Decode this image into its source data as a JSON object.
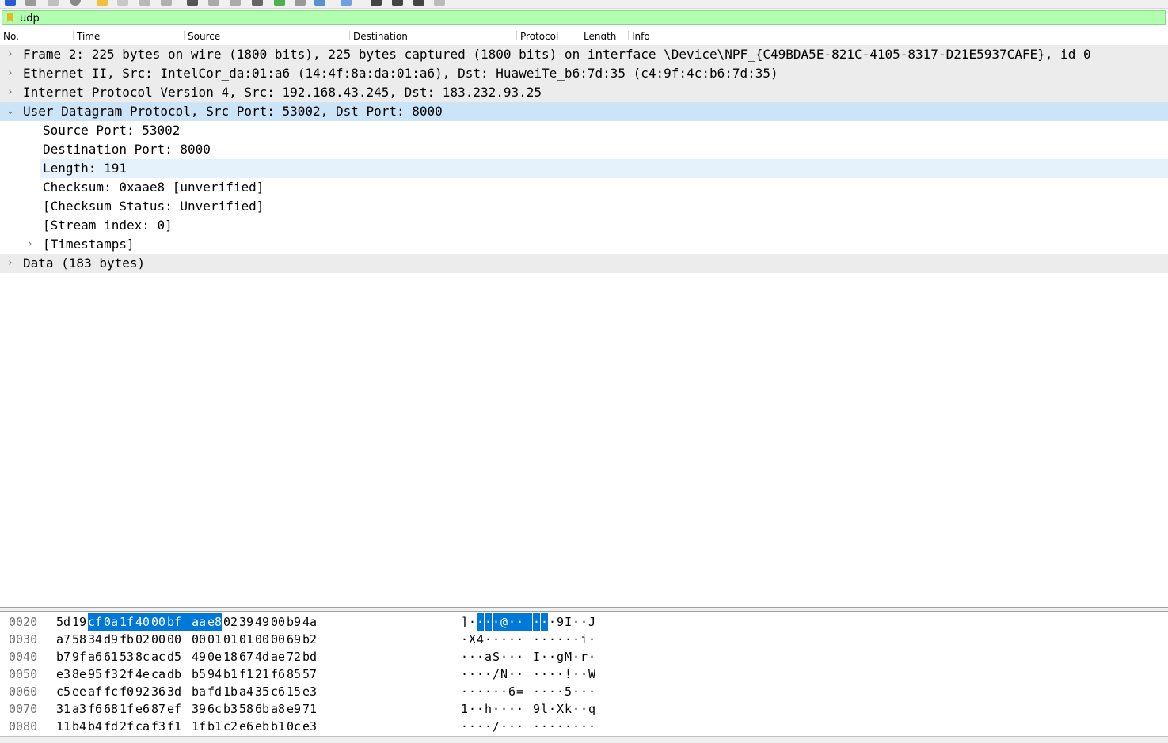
{
  "filter": {
    "value": "udp"
  },
  "packet_list": {
    "columns": [
      "No.",
      "Time",
      "Source",
      "Destination",
      "Protocol",
      "Length",
      "Info"
    ]
  },
  "detail": {
    "rows": [
      {
        "text": "Frame 2: 225 bytes on wire (1800 bits), 225 bytes captured (1800 bits) on interface \\Device\\NPF_{C49BDA5E-821C-4105-8317-D21E5937CAFE}, id 0",
        "expanded": false
      },
      {
        "text": "Ethernet II, Src: IntelCor_da:01:a6 (14:4f:8a:da:01:a6), Dst: HuaweiTe_b6:7d:35 (c4:9f:4c:b6:7d:35)",
        "expanded": false
      },
      {
        "text": "Internet Protocol Version 4, Src: 192.168.43.245, Dst: 183.232.93.25",
        "expanded": false
      },
      {
        "text": "User Datagram Protocol, Src Port: 53002, Dst Port: 8000",
        "expanded": true,
        "selected": true
      },
      {
        "text": "Source Port: 53002"
      },
      {
        "text": "Destination Port: 8000"
      },
      {
        "text": "Length: 191",
        "hovered": true
      },
      {
        "text": "Checksum: 0xaae8 [unverified]"
      },
      {
        "text": "[Checksum Status: Unverified]"
      },
      {
        "text": "[Stream index: 0]"
      },
      {
        "text": "[Timestamps]",
        "expanded": false
      },
      {
        "text": "Data (183 bytes)",
        "expanded": false
      }
    ]
  },
  "bytes": {
    "rows": [
      {
        "offset": "0020",
        "hex": [
          "5d",
          "19",
          "cf",
          "0a",
          "1f",
          "40",
          "00",
          "bf",
          "aa",
          "e8",
          "02",
          "39",
          "49",
          "00",
          "b9",
          "4a"
        ],
        "ascii": [
          "]",
          "·",
          "·",
          "·",
          "·",
          "@",
          "·",
          "·",
          "·",
          "·",
          "·",
          "9",
          "I",
          "·",
          "·",
          "J"
        ]
      },
      {
        "offset": "0030",
        "hex": [
          "a7",
          "58",
          "34",
          "d9",
          "fb",
          "02",
          "00",
          "00",
          "00",
          "01",
          "01",
          "01",
          "00",
          "00",
          "69",
          "b2"
        ],
        "ascii": [
          "·",
          "X",
          "4",
          "·",
          "·",
          "·",
          "·",
          "·",
          "·",
          "·",
          "·",
          "·",
          "·",
          "·",
          "i",
          "·"
        ]
      },
      {
        "offset": "0040",
        "hex": [
          "b7",
          "9f",
          "a6",
          "61",
          "53",
          "8c",
          "ac",
          "d5",
          "49",
          "0e",
          "18",
          "67",
          "4d",
          "ae",
          "72",
          "bd"
        ],
        "ascii": [
          "·",
          "·",
          "·",
          "a",
          "S",
          "·",
          "·",
          "·",
          "I",
          "·",
          "·",
          "g",
          "M",
          "·",
          "r",
          "·"
        ]
      },
      {
        "offset": "0050",
        "hex": [
          "e3",
          "8e",
          "95",
          "f3",
          "2f",
          "4e",
          "ca",
          "db",
          "b5",
          "94",
          "b1",
          "f1",
          "21",
          "f6",
          "85",
          "57"
        ],
        "ascii": [
          "·",
          "·",
          "·",
          "·",
          "/",
          "N",
          "·",
          "·",
          "·",
          "·",
          "·",
          "·",
          "!",
          "·",
          "·",
          "W"
        ]
      },
      {
        "offset": "0060",
        "hex": [
          "c5",
          "ee",
          "af",
          "fc",
          "f0",
          "92",
          "36",
          "3d",
          "ba",
          "fd",
          "1b",
          "a4",
          "35",
          "c6",
          "15",
          "e3"
        ],
        "ascii": [
          "·",
          "·",
          "·",
          "·",
          "·",
          "·",
          "6",
          "=",
          "·",
          "·",
          "·",
          "·",
          "5",
          "·",
          "·",
          "·"
        ]
      },
      {
        "offset": "0070",
        "hex": [
          "31",
          "a3",
          "f6",
          "68",
          "1f",
          "e6",
          "87",
          "ef",
          "39",
          "6c",
          "b3",
          "58",
          "6b",
          "a8",
          "e9",
          "71"
        ],
        "ascii": [
          "1",
          "·",
          "·",
          "h",
          "·",
          "·",
          "·",
          "·",
          "9",
          "l",
          "·",
          "X",
          "k",
          "·",
          "·",
          "q"
        ]
      },
      {
        "offset": "0080",
        "hex": [
          "11",
          "b4",
          "b4",
          "fd",
          "2f",
          "ca",
          "f3",
          "f1",
          "1f",
          "b1",
          "c2",
          "e6",
          "eb",
          "b1",
          "0c",
          "e3"
        ],
        "ascii": [
          "·",
          "·",
          "·",
          "·",
          "/",
          "·",
          "·",
          "·",
          "·",
          "·",
          "·",
          "·",
          "·",
          "·",
          "·",
          "·"
        ]
      }
    ],
    "highlight": {
      "row": 0,
      "from": 2,
      "to": 9
    }
  },
  "colors": {
    "filter_bg": "#afffaf",
    "selected_row": "#cce4f7",
    "hover_row": "#e5f1fb",
    "byte_highlight": "#0078d7"
  }
}
